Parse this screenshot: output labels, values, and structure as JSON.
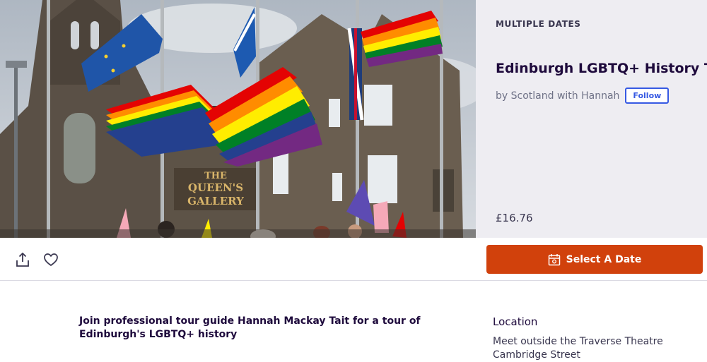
{
  "event": {
    "date_label": "MULTIPLE DATES",
    "title": "Edinburgh LGBTQ+ History Tour",
    "organizer_text": "by Scotland with Hannah",
    "follow_label": "Follow",
    "price": "£16.76"
  },
  "image": {
    "sign_line1": "THE",
    "sign_line2": "QUEEN'S",
    "sign_line3": "GALLERY"
  },
  "actions": {
    "share_icon": "share-icon",
    "like_icon": "heart-icon",
    "select_date_label": "Select A Date",
    "calendar_icon": "calendar-icon"
  },
  "summary": "Join professional tour guide Hannah Mackay Tait for a tour of Edinburgh's LGBTQ+ history",
  "location": {
    "heading": "Location",
    "line1": "Meet outside the Traverse Theatre",
    "line2": "Cambridge Street"
  },
  "colors": {
    "accent": "#d1410c",
    "follow_blue": "#3659e3",
    "panel_bg": "#eeedf2"
  }
}
